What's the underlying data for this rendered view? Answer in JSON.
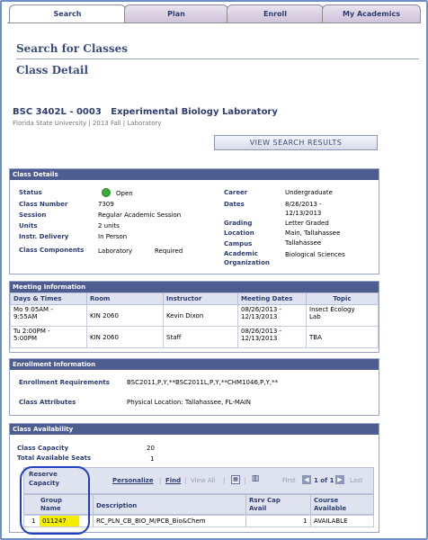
{
  "tabs": [
    {
      "label": "Search",
      "active": true
    },
    {
      "label": "Plan",
      "active": false
    },
    {
      "label": "Enroll",
      "active": false
    },
    {
      "label": "My Academics",
      "active": false
    }
  ],
  "page": {
    "search_heading": "Search for Classes",
    "detail_heading": "Class Detail",
    "course_title": "BSC 3402L - 0003   Experimental Biology Laboratory",
    "course_subtitle": "Florida State University | 2013 Fall | Laboratory",
    "view_results_button": "View Search Results"
  },
  "class_details": {
    "header": "Class Details",
    "left": [
      {
        "label": "Status",
        "value": "Open"
      },
      {
        "label": "Class Number",
        "value": "7309"
      },
      {
        "label": "Session",
        "value": "Regular Academic Session"
      },
      {
        "label": "Units",
        "value": "2 units"
      },
      {
        "label": "Instr. Delivery",
        "value": "In Person"
      },
      {
        "label": "Class Components",
        "value": "Laboratory",
        "extra": "Required"
      }
    ],
    "right": [
      {
        "label": "Career",
        "value": "Undergraduate"
      },
      {
        "label": "Dates",
        "value": "8/26/2013 -",
        "value2": "12/13/2013"
      },
      {
        "label": "Grading",
        "value": "Letter Graded"
      },
      {
        "label": "Location",
        "value": "Main, Tallahassee"
      },
      {
        "label": "Campus",
        "value": "Tallahassee"
      },
      {
        "label": "Academic",
        "label2": "Organization",
        "value": "Biological Sciences"
      }
    ],
    "status_color": "#3aac3a"
  },
  "meeting": {
    "header": "Meeting Information",
    "columns": [
      "Days & Times",
      "Room",
      "Instructor",
      "Meeting Dates",
      "Topic"
    ],
    "rows": [
      {
        "days": "Mo 9:05AM -",
        "days2": "9:55AM",
        "room": "KIN 2060",
        "instructor": "Kevin Dixon",
        "dates": "08/26/2013 -",
        "dates2": "12/13/2013",
        "topic": "Insect Ecology",
        "topic2": "Lab"
      },
      {
        "days": "Tu 2:00PM -",
        "days2": "5:00PM",
        "room": "KIN 2060",
        "instructor": "Staff",
        "dates": "08/26/2013 -",
        "dates2": "12/13/2013",
        "topic": "TBA",
        "topic2": ""
      }
    ]
  },
  "enrollment": {
    "header": "Enrollment Information",
    "req_label": "Enrollment Requirements",
    "req_value": "BSC2011,P,Y,**BSC2011L,P,Y,**CHM1046,P,Y,**",
    "attr_label": "Class Attributes",
    "attr_value": "Physical Location: Tallahassee, FL-MAIN"
  },
  "availability": {
    "header": "Class Availability",
    "capacity_label": "Class Capacity",
    "capacity_value": "20",
    "seats_label": "Total Available Seats",
    "seats_value": "1",
    "reserve_label": "Reserve",
    "reserve_label2": "Capacity",
    "personalize": "Personalize",
    "find": "Find",
    "view_all": "View All",
    "first": "First",
    "range": "1 of 1",
    "last": "Last",
    "columns": [
      "Group",
      "Name",
      "Description",
      "Rsrv Cap",
      "Avail",
      "Course",
      "Available"
    ],
    "row": {
      "index": "1",
      "group": "011247",
      "description": "RC_PLN_CB_BIO_M/PCB_Bio&Chem",
      "rsrv": "1",
      "course": "AVAILABLE"
    },
    "highlight_color": "#f4ee00",
    "circle_color": "#1f3fbf"
  }
}
